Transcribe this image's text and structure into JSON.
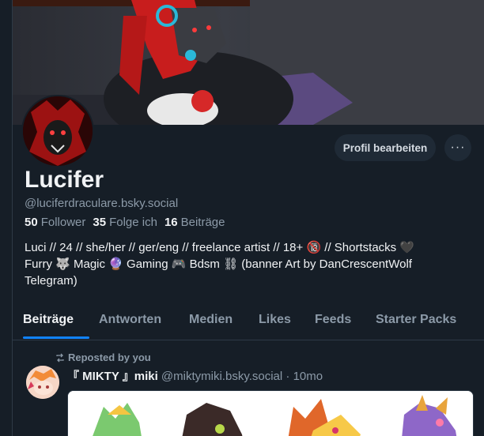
{
  "profile": {
    "display_name": "Lucifer",
    "handle": "@luciferdraculare.bsky.social",
    "stats": {
      "followers_count": "50",
      "followers_label": "Follower",
      "following_count": "35",
      "following_label": "Folge ich",
      "posts_count": "16",
      "posts_label": "Beiträge"
    },
    "bio": [
      "Luci // 24 // she/her // ger/eng // freelance artist // 18+ 🔞 // Shortstacks 🖤",
      "Furry 🐺 Magic 🔮 Gaming 🎮 Bdsm ⛓ (banner Art by DanCrescentWolf",
      "Telegram)"
    ]
  },
  "actions": {
    "edit_profile_label": "Profil bearbeiten",
    "more_label": "···"
  },
  "tabs": [
    {
      "label": "Beiträge",
      "active": true
    },
    {
      "label": "Antworten",
      "active": false
    },
    {
      "label": "Medien",
      "active": false
    },
    {
      "label": "Likes",
      "active": false
    },
    {
      "label": "Feeds",
      "active": false
    },
    {
      "label": "Starter Packs",
      "active": false
    }
  ],
  "feed": {
    "post": {
      "repost_label": "Reposted by you",
      "author_name": "『 MIKTY 』miki",
      "author_handle": "@miktymiki.bsky.social",
      "separator": "·",
      "age": "10mo"
    }
  },
  "colors": {
    "background": "#161e27",
    "accent": "#1083fe",
    "muted_text": "#8c9aa8",
    "button_bg": "#1f2a36"
  },
  "icons": {
    "repost": "repost-icon",
    "more": "ellipsis-icon"
  }
}
